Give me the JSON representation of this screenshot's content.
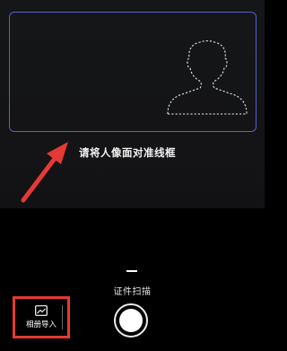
{
  "camera": {
    "hint_text": "请将人像面对准线框",
    "frame_color": "#5561c9"
  },
  "controls": {
    "mode_label": "证件扫描",
    "album_import_label": "相册导入"
  },
  "annotation": {
    "highlight_color": "#e53935"
  },
  "icons": [
    "portrait-silhouette-icon",
    "arrow-annotation-icon",
    "image-gallery-icon",
    "shutter-button"
  ]
}
